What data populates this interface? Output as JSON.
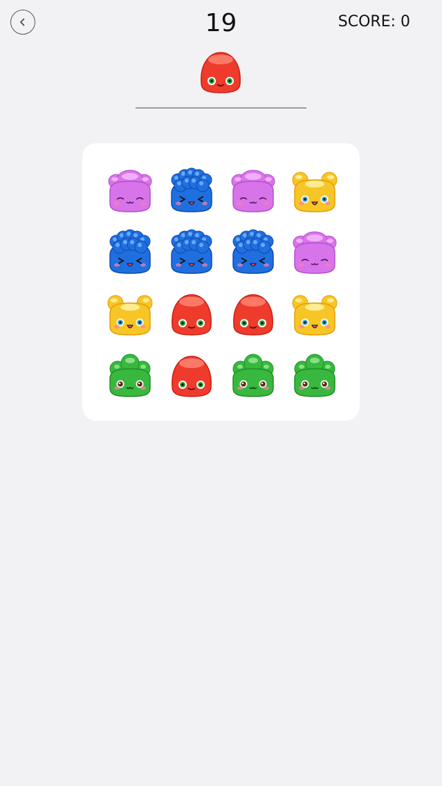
{
  "header": {
    "back_icon": "back-chevron-icon",
    "timer": "19",
    "score_label": "SCORE: 0"
  },
  "target": {
    "color": "red",
    "face": "eyes-open"
  },
  "board": {
    "background": "#ffffff",
    "rows": [
      [
        "pink",
        "blue",
        "pink",
        "yellow"
      ],
      [
        "blue",
        "blue",
        "blue",
        "pink"
      ],
      [
        "yellow",
        "red",
        "red",
        "yellow"
      ],
      [
        "green",
        "red",
        "green",
        "green"
      ]
    ]
  },
  "palette": {
    "red": "#ef3b2c",
    "blue": "#1f6fe0",
    "pink": "#d874ea",
    "yellow": "#f7c626",
    "green": "#38b83e"
  }
}
